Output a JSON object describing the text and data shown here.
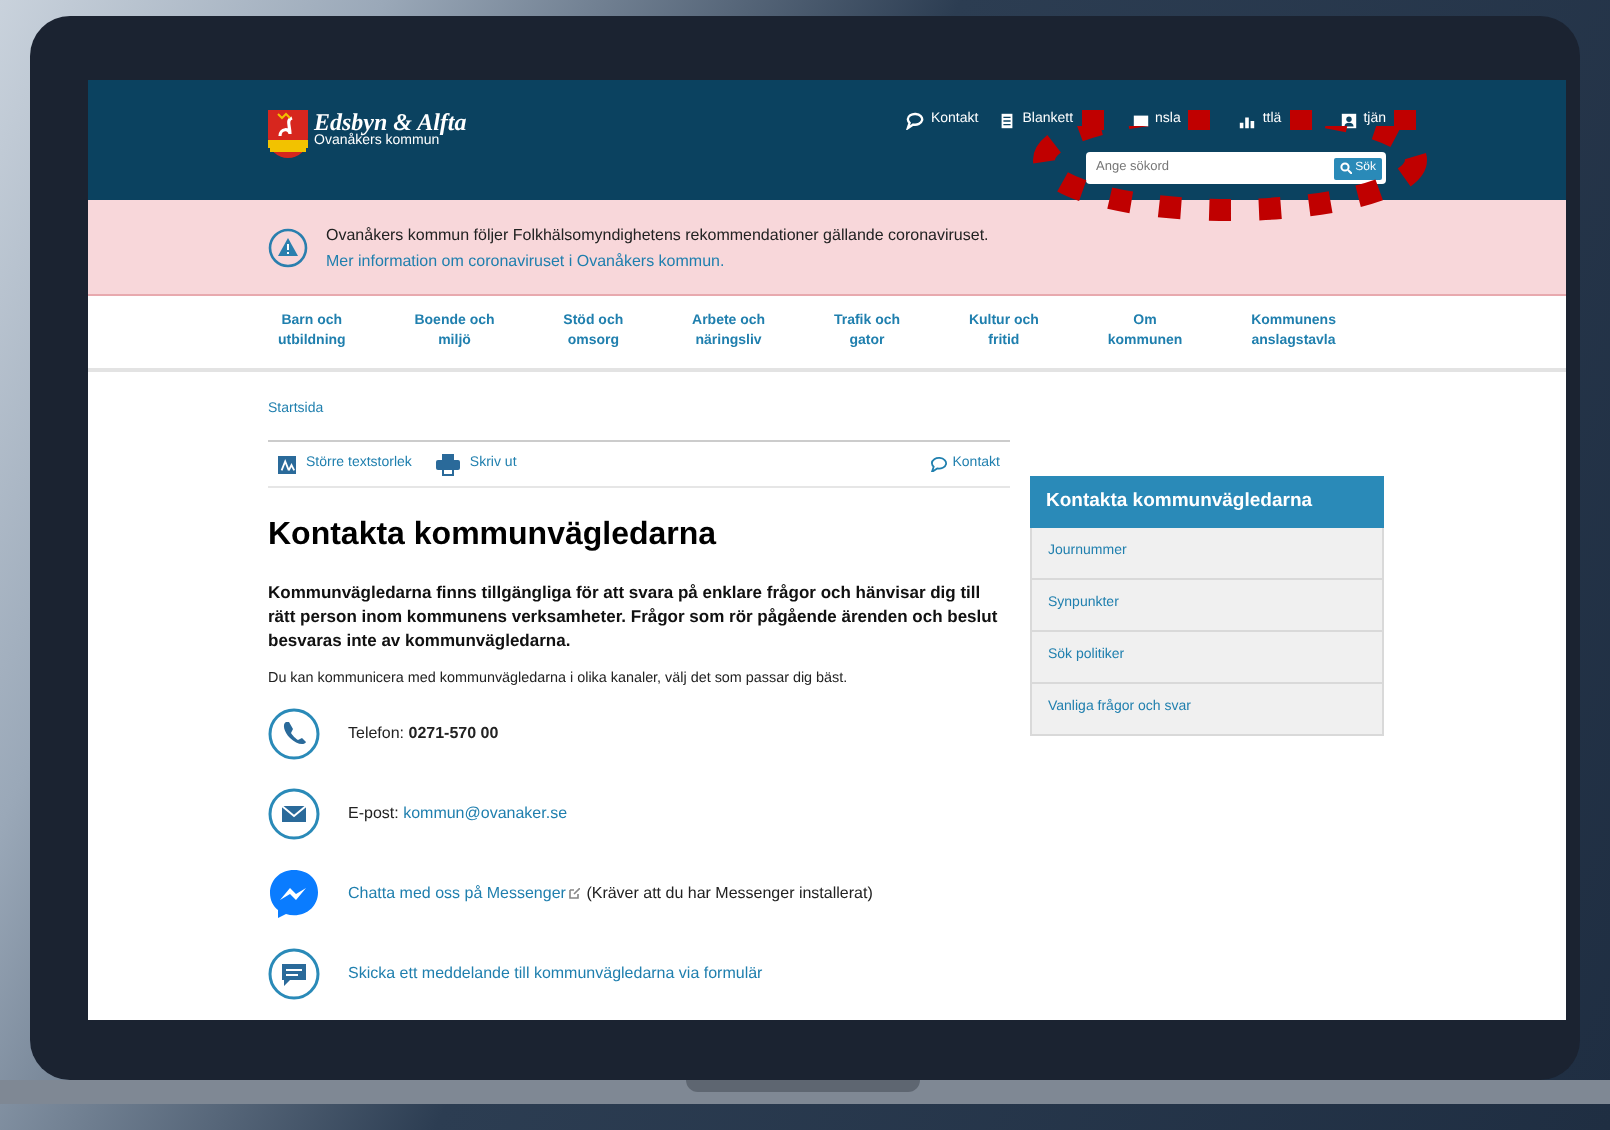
{
  "logo": {
    "title": "Edsbyn & Alfta",
    "subtitle": "Ovanåkers kommun"
  },
  "top_links": [
    {
      "kind": "chat",
      "label": "Kontakt"
    },
    {
      "kind": "document",
      "label": "Blankett"
    },
    {
      "kind": "board",
      "label": "nsla"
    },
    {
      "kind": "chart",
      "label": "ttlä"
    },
    {
      "kind": "person",
      "label": "tjän"
    }
  ],
  "search": {
    "placeholder": "Ange sökord",
    "button": "Sök"
  },
  "alert": {
    "text": "Ovanåkers kommun följer Folkhälsomyndighetens rekommendationer gällande coronaviruset.",
    "link": "Mer information om coronaviruset i Ovanåkers kommun."
  },
  "nav": [
    {
      "lines": [
        "Barn och",
        "utbildning"
      ]
    },
    {
      "lines": [
        "Boende och",
        "miljö"
      ]
    },
    {
      "lines": [
        "Stöd och",
        "omsorg"
      ]
    },
    {
      "lines": [
        "Arbete och",
        "näringsliv"
      ]
    },
    {
      "lines": [
        "Trafik och",
        "gator"
      ]
    },
    {
      "lines": [
        "Kultur och",
        "fritid"
      ]
    },
    {
      "lines": [
        "Om",
        "kommunen"
      ]
    },
    {
      "lines": [
        "Kommunens",
        "anslagstavla"
      ]
    }
  ],
  "breadcrumb": "Startsida",
  "tools": [
    {
      "kind": "textsize",
      "label": "Större textstorlek"
    },
    {
      "kind": "print",
      "label": "Skriv ut"
    }
  ],
  "contact_link": "Kontakt",
  "heading": "Kontakta kommunvägledarna",
  "lead": "Kommunvägledarna finns tillgängliga för att svara på enklare frågor och hänvisar dig till rätt person inom kommunens verksamheter. Frågor som rör pågående ärenden och beslut besvaras inte av kommunvägledarna.",
  "intro": "Du kan kommunicera med kommunvägledarna i olika kanaler, välj det som passar dig bäst.",
  "channels": [
    {
      "kind": "phone",
      "text": "Telefon: **0271-570 00**"
    },
    {
      "kind": "email",
      "text": "E-post:",
      "link": "kommun@ovanaker.se"
    },
    {
      "kind": "messenger",
      "link": "Chatta med oss på Messenger",
      "text": "(Kräver att du har Messenger installerat)"
    },
    {
      "kind": "form",
      "link": "Skicka ett meddelande till kommunvägledarna via formulär"
    }
  ],
  "sidebar": {
    "title": "Kontakta kommunvägledarna",
    "items": [
      "Journummer",
      "Synpunkter",
      "Sök politiker",
      "Vanliga frågor och svar"
    ]
  }
}
